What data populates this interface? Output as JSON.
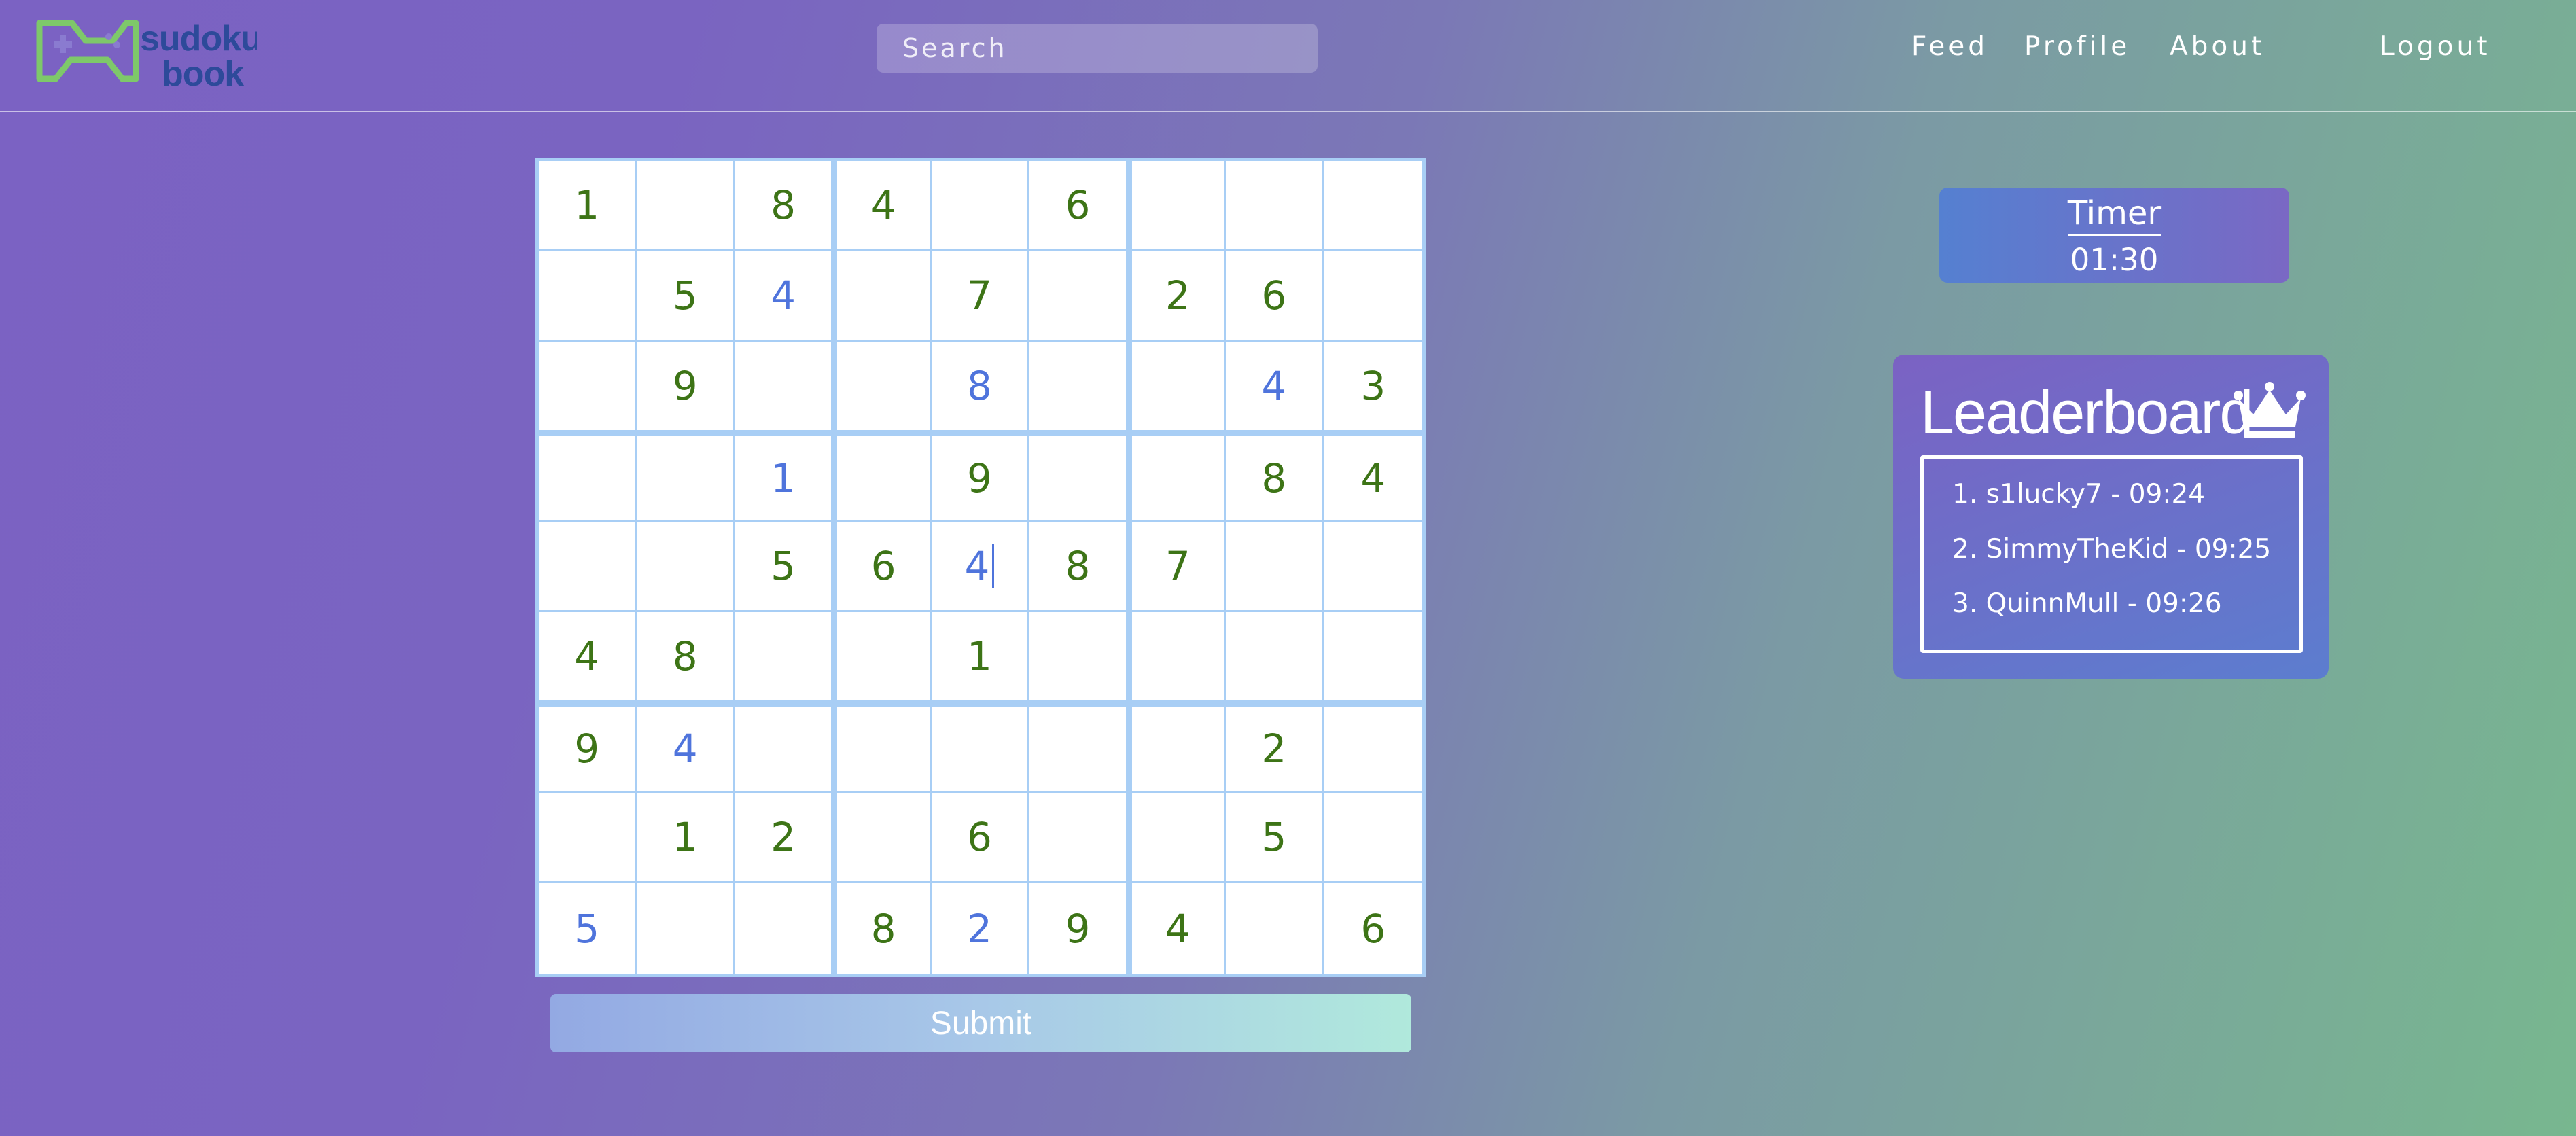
{
  "header": {
    "logo": {
      "line1": "sudoku",
      "line2": "book",
      "icon": "gamepad-icon"
    },
    "search_placeholder": "Search",
    "nav": {
      "feed": "Feed",
      "profile": "Profile",
      "about": "About",
      "logout": "Logout"
    }
  },
  "board": {
    "rows": [
      [
        [
          "1",
          "g"
        ],
        [
          "",
          ""
        ],
        [
          "8",
          "g"
        ],
        [
          "4",
          "g"
        ],
        [
          "",
          ""
        ],
        [
          "6",
          "g"
        ],
        [
          "",
          ""
        ],
        [
          "",
          ""
        ],
        [
          "",
          ""
        ]
      ],
      [
        [
          "",
          ""
        ],
        [
          "5",
          "g"
        ],
        [
          "4",
          "e"
        ],
        [
          "",
          ""
        ],
        [
          "7",
          "g"
        ],
        [
          "",
          ""
        ],
        [
          "2",
          "g"
        ],
        [
          "6",
          "g"
        ],
        [
          "",
          ""
        ]
      ],
      [
        [
          "",
          ""
        ],
        [
          "9",
          "g"
        ],
        [
          "",
          ""
        ],
        [
          "",
          ""
        ],
        [
          "8",
          "e"
        ],
        [
          "",
          ""
        ],
        [
          "",
          ""
        ],
        [
          "4",
          "e"
        ],
        [
          "3",
          "g"
        ]
      ],
      [
        [
          "",
          ""
        ],
        [
          "",
          ""
        ],
        [
          "1",
          "e"
        ],
        [
          "",
          ""
        ],
        [
          "9",
          "g"
        ],
        [
          "",
          ""
        ],
        [
          "",
          ""
        ],
        [
          "8",
          "g"
        ],
        [
          "4",
          "g"
        ]
      ],
      [
        [
          "",
          ""
        ],
        [
          "",
          ""
        ],
        [
          "5",
          "g"
        ],
        [
          "6",
          "g"
        ],
        [
          "4",
          "e"
        ],
        [
          "8",
          "g"
        ],
        [
          "7",
          "g"
        ],
        [
          "",
          ""
        ],
        [
          "",
          ""
        ]
      ],
      [
        [
          "4",
          "g"
        ],
        [
          "8",
          "g"
        ],
        [
          "",
          ""
        ],
        [
          "",
          ""
        ],
        [
          "1",
          "g"
        ],
        [
          "",
          ""
        ],
        [
          "",
          ""
        ],
        [
          "",
          ""
        ],
        [
          "",
          ""
        ]
      ],
      [
        [
          "9",
          "g"
        ],
        [
          "4",
          "e"
        ],
        [
          "",
          ""
        ],
        [
          "",
          ""
        ],
        [
          "",
          ""
        ],
        [
          "",
          ""
        ],
        [
          "",
          ""
        ],
        [
          "2",
          "g"
        ],
        [
          "",
          ""
        ]
      ],
      [
        [
          "",
          ""
        ],
        [
          "1",
          "g"
        ],
        [
          "2",
          "g"
        ],
        [
          "",
          ""
        ],
        [
          "6",
          "g"
        ],
        [
          "",
          ""
        ],
        [
          "",
          ""
        ],
        [
          "5",
          "g"
        ],
        [
          "",
          ""
        ]
      ],
      [
        [
          "5",
          "e"
        ],
        [
          "",
          ""
        ],
        [
          "",
          ""
        ],
        [
          "8",
          "g"
        ],
        [
          "2",
          "e"
        ],
        [
          "9",
          "g"
        ],
        [
          "4",
          "g"
        ],
        [
          "",
          ""
        ],
        [
          "6",
          "g"
        ]
      ]
    ],
    "colors": {
      "given": "#3d7416",
      "entered": "#4f74dc",
      "grid": "#a8cef5"
    },
    "submit_label": "Submit"
  },
  "timer": {
    "title": "Timer",
    "value": "01:30"
  },
  "leaderboard": {
    "title": "Leaderboard",
    "icon": "crown-icon",
    "entries": [
      "1. s1lucky7 - 09:24",
      "2. SimmyTheKid - 09:25",
      "3. QuinnMull - 09:26"
    ]
  }
}
